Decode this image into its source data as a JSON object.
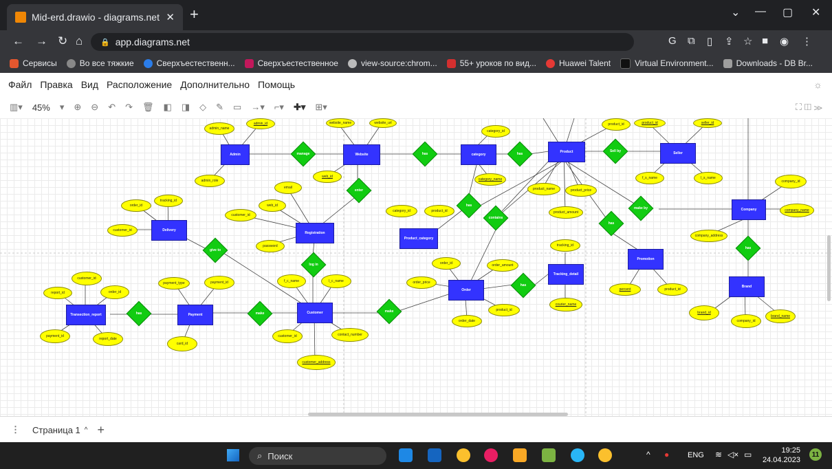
{
  "browser": {
    "tab_title": "Mid-erd.drawio - diagrams.net",
    "url": "app.diagrams.net",
    "bookmarks": [
      "Сервисы",
      "Во все тяжкие",
      "Сверхъестественн...",
      "Сверхъестественное",
      "view-source:chrom...",
      "55+ уроков по вид...",
      "Huawei Talent",
      "Virtual Environment...",
      "Downloads - DB Br..."
    ]
  },
  "menu": [
    "Файл",
    "Правка",
    "Вид",
    "Расположение",
    "Дополнительно",
    "Помощь"
  ],
  "toolbar": {
    "zoom": "45%"
  },
  "page": {
    "tab_label": "Страница 1"
  },
  "taskbar": {
    "search": "Поиск",
    "lang": "ENG",
    "time": "19:25",
    "date": "24.04.2023",
    "badge": "11"
  },
  "diagram": {
    "entities": [
      "Admin",
      "Website",
      "category",
      "Product",
      "Seller",
      "Delivery",
      "Registration",
      "Product_category",
      "Company",
      "Order",
      "Tracking_detail",
      "Promotion",
      "Transection_report",
      "Payment",
      "Customer",
      "Brand"
    ],
    "relations": [
      "manage",
      "has",
      "has",
      "Sell by",
      "enter",
      "has",
      "contains",
      "give to",
      "log in",
      "make by",
      "has",
      "has",
      "has",
      "has",
      "make",
      "make"
    ],
    "attributes": {
      "admin": [
        "admin_name",
        "admin_id",
        "admin_role"
      ],
      "website": [
        "website_name",
        "website_url",
        "web_id"
      ],
      "category": [
        "category_id",
        "category_name"
      ],
      "product": [
        "product_id",
        "product_name",
        "product_price",
        "product_amount"
      ],
      "seller": [
        "product_id",
        "seller_id",
        "f_s_name",
        "l_s_name"
      ],
      "delivery": [
        "order_id",
        "tracking_id",
        "customer_id"
      ],
      "registration": [
        "email",
        "web_id",
        "customer_id",
        "password"
      ],
      "product_category": [
        "category_id",
        "product_id"
      ],
      "company": [
        "company_id",
        "company_name",
        "company_address"
      ],
      "order": [
        "order_id",
        "order_amount",
        "order_price",
        "product_id",
        "order_date"
      ],
      "tracking": [
        "tracking_id",
        "courier_name"
      ],
      "promotion": [
        "percent",
        "product_id"
      ],
      "transaction": [
        "customer_id",
        "report_id",
        "order_id",
        "payment_id",
        "report_date"
      ],
      "payment": [
        "payment_type",
        "payment_id",
        "card_id"
      ],
      "customer": [
        "f_c_name",
        "l_c_name",
        "customer_id",
        "contact_number",
        "customer_address"
      ],
      "brand": [
        "brand_id",
        "company_id",
        "brand_name"
      ]
    }
  }
}
